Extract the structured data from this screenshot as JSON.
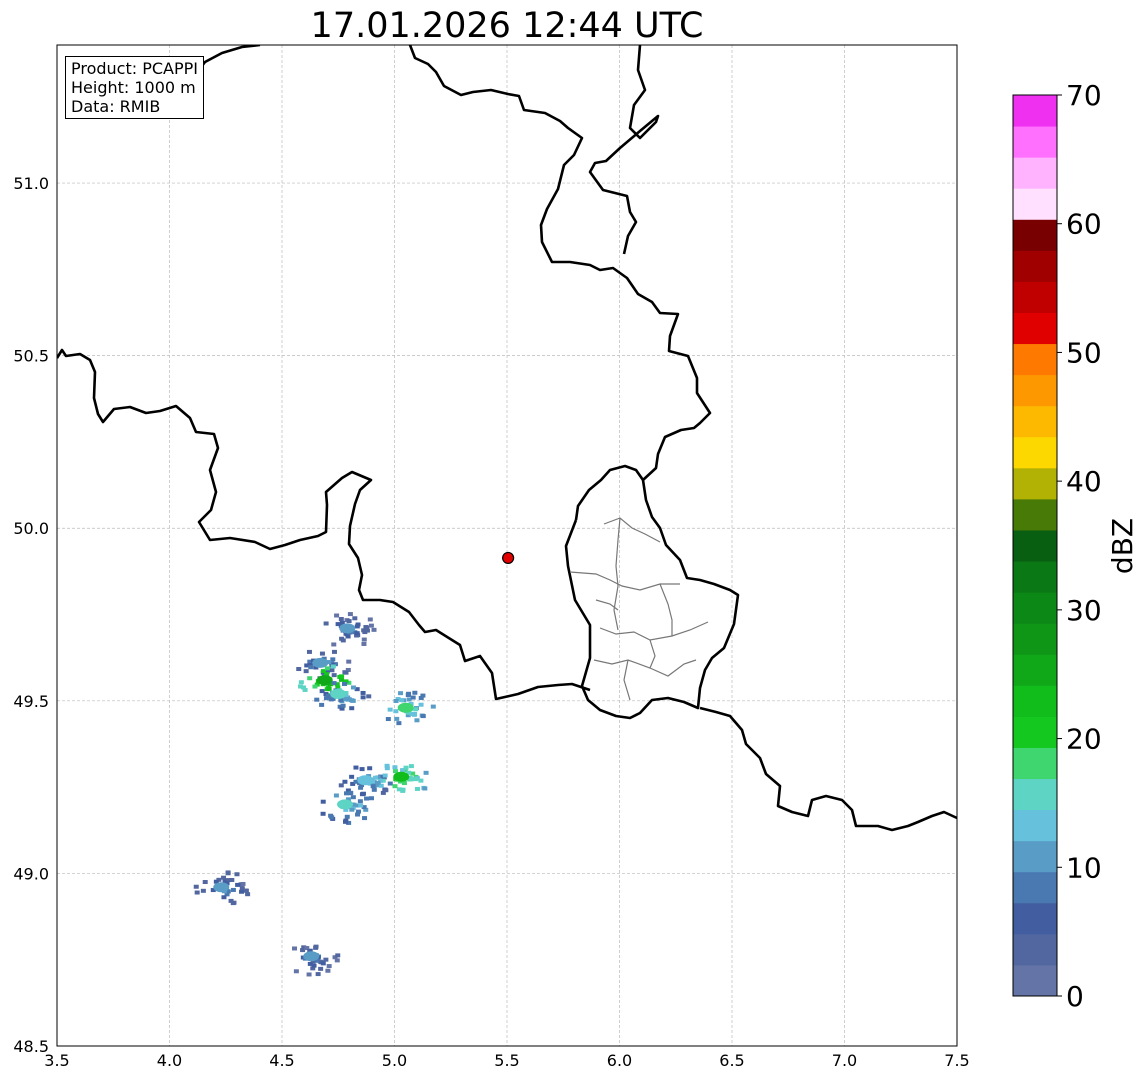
{
  "title": "17.01.2026 12:44 UTC",
  "info": {
    "product": "Product: PCAPPI",
    "height": "Height: 1000 m",
    "data": "Data: RMIB"
  },
  "map": {
    "lon_range": [
      3.5,
      7.5
    ],
    "lat_range": [
      48.5,
      51.4
    ],
    "x_ticks": [
      "3.5",
      "4.0",
      "4.5",
      "5.0",
      "5.5",
      "6.0",
      "6.5",
      "7.0",
      "7.5"
    ],
    "y_ticks": [
      "48.5",
      "49.0",
      "49.5",
      "50.0",
      "50.5",
      "51.0"
    ],
    "grid": true,
    "radar_site": {
      "lon": 5.505,
      "lat": 49.914,
      "color": "#e00000"
    },
    "echo_cells": [
      {
        "lon": 4.67,
        "lat": 49.61,
        "dbz": 12
      },
      {
        "lon": 4.69,
        "lat": 49.56,
        "dbz": 26
      },
      {
        "lon": 4.79,
        "lat": 49.71,
        "dbz": 10
      },
      {
        "lon": 4.75,
        "lat": 49.52,
        "dbz": 15
      },
      {
        "lon": 5.05,
        "lat": 49.48,
        "dbz": 18
      },
      {
        "lon": 4.87,
        "lat": 49.27,
        "dbz": 14
      },
      {
        "lon": 5.03,
        "lat": 49.28,
        "dbz": 22
      },
      {
        "lon": 4.78,
        "lat": 49.2,
        "dbz": 16
      },
      {
        "lon": 4.23,
        "lat": 48.96,
        "dbz": 12
      },
      {
        "lon": 4.63,
        "lat": 48.76,
        "dbz": 10
      }
    ]
  },
  "colorbar": {
    "label": "dBZ",
    "range": [
      0,
      70
    ],
    "ticks": [
      "0",
      "10",
      "20",
      "30",
      "40",
      "50",
      "60",
      "70"
    ],
    "colors": [
      "#6574a6",
      "#52679f",
      "#425ea0",
      "#4a78b0",
      "#599dc6",
      "#66c1dc",
      "#5dd4c4",
      "#3fd56f",
      "#14c81f",
      "#11bd1b",
      "#10a819",
      "#0f9617",
      "#0c8816",
      "#0a7814",
      "#085e11",
      "#487a08",
      "#b2b204",
      "#fdd800",
      "#fdb800",
      "#fd9800",
      "#fd7900",
      "#e00000",
      "#c00000",
      "#a00000",
      "#780000",
      "#ffe0ff",
      "#ffb3ff",
      "#ff70ff",
      "#f030f0"
    ]
  }
}
